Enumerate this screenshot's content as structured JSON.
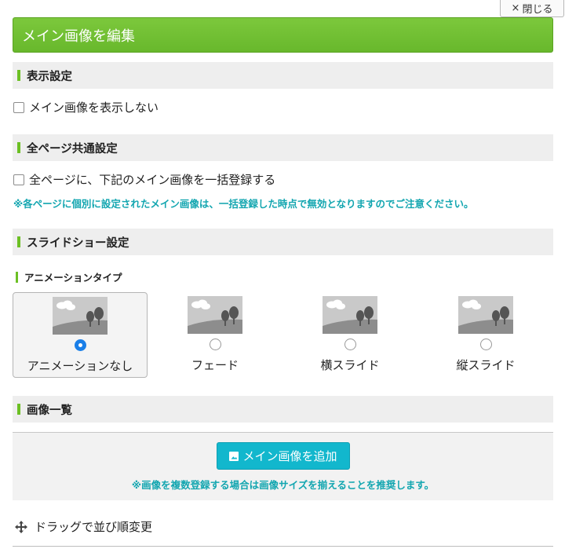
{
  "close": {
    "icon": "×",
    "label": "閉じる"
  },
  "title": "メイン画像を編集",
  "display_settings": {
    "heading": "表示設定",
    "hide_label": "メイン画像を表示しない",
    "hide_checked": false
  },
  "common_settings": {
    "heading": "全ページ共通設定",
    "bulk_label": "全ページに、下記のメイン画像を一括登録する",
    "bulk_checked": false,
    "note": "※各ページに個別に設定されたメイン画像は、一括登録した時点で無効となりますのでご注意ください。"
  },
  "slideshow": {
    "heading": "スライドショー設定",
    "animation_heading": "アニメーションタイプ",
    "options": [
      {
        "label": "アニメーションなし",
        "selected": true
      },
      {
        "label": "フェード",
        "selected": false
      },
      {
        "label": "横スライド",
        "selected": false
      },
      {
        "label": "縦スライド",
        "selected": false
      }
    ]
  },
  "image_list": {
    "heading": "画像一覧",
    "add_button": "メイン画像を追加",
    "add_icon": "image-icon",
    "note": "※画像を複数登録する場合は画像サイズを揃えることを推奨します。"
  },
  "drag": {
    "icon": "move-icon",
    "label": "ドラッグで並び順変更"
  },
  "colors": {
    "accent": "#6cc024",
    "teal": "#13a6b0",
    "button": "#12b7cd",
    "radio": "#1a7fe8"
  }
}
